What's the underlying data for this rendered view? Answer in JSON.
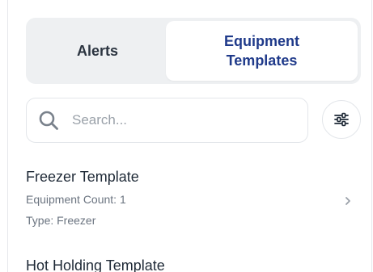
{
  "tabs": [
    {
      "label": "Alerts",
      "active": false
    },
    {
      "label": "Equipment Templates",
      "active": true
    }
  ],
  "search": {
    "placeholder": "Search..."
  },
  "filter": {
    "icon": "sliders-icon"
  },
  "templates": [
    {
      "name": "Freezer Template",
      "equipment_count": "Equipment Count: 1",
      "type": "Type: Freezer"
    },
    {
      "name": "Hot Holding Template"
    }
  ],
  "colors": {
    "accent": "#1f3a8a",
    "tab_track": "#eef0f2",
    "border": "#e3e6ea",
    "muted_text": "#6b7480"
  }
}
